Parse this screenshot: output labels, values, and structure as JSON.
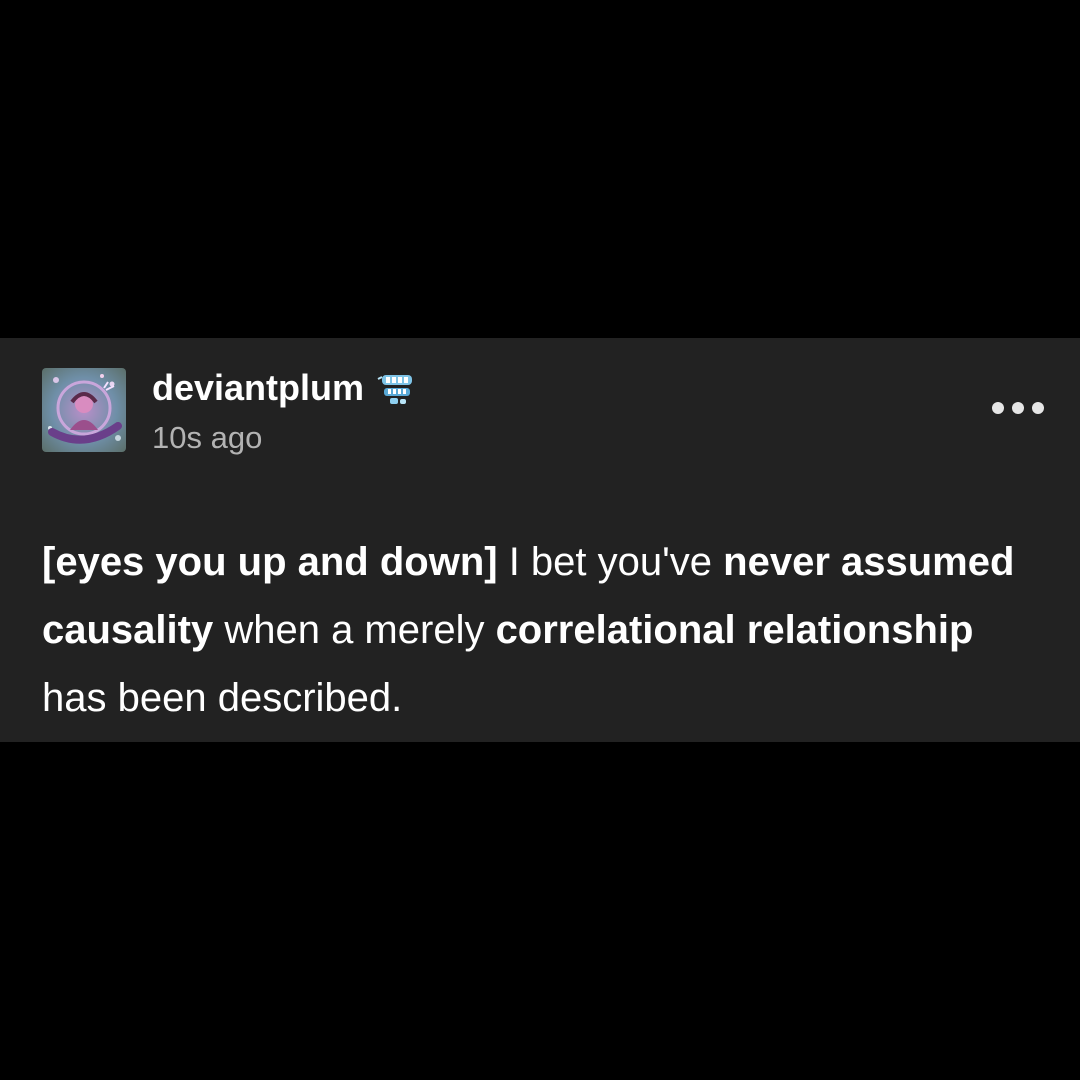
{
  "post": {
    "username": "deviantplum",
    "timestamp": "10s ago",
    "body_segments": [
      {
        "text": "[eyes you up and down]",
        "bold": true
      },
      {
        "text": " I bet you've ",
        "bold": false
      },
      {
        "text": "never assumed causality",
        "bold": true
      },
      {
        "text": " when a merely ",
        "bold": false
      },
      {
        "text": "correlational relationship",
        "bold": true
      },
      {
        "text": " has been described.",
        "bold": false
      }
    ]
  },
  "icons": {
    "avatar": "avatar-image",
    "badge": "teeth-badge-icon",
    "more": "more-options-icon"
  },
  "colors": {
    "page_background": "#000000",
    "card_background": "#222222",
    "text_primary": "#ffffff",
    "text_secondary": "#b3b3b3"
  }
}
